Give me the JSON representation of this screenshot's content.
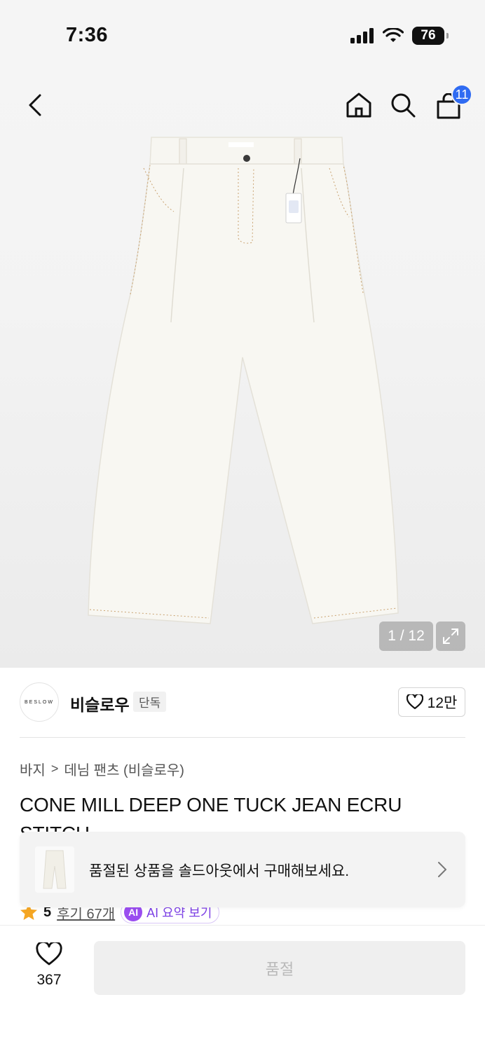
{
  "status_bar": {
    "time": "7:36",
    "battery": "76"
  },
  "nav": {
    "cart_count": "11"
  },
  "gallery": {
    "counter": "1 / 12",
    "product_tag_text": "BESLOW"
  },
  "brand": {
    "logo_text": "BESLOW",
    "name": "비슬로우",
    "tag": "단독",
    "likes": "12만"
  },
  "breadcrumb": {
    "category": "바지",
    "separator": ">",
    "subcategory": "데님 팬츠 (비슬로우)"
  },
  "product": {
    "title": "CONE MILL DEEP ONE TUCK JEAN ECRU STITCH"
  },
  "rating": {
    "score": "5",
    "reviews": "후기 67개",
    "ai_badge": "AI",
    "ai_label": "AI 요약 보기"
  },
  "toast": {
    "message": "품절된 상품을 솔드아웃에서 구매해보세요."
  },
  "bottom": {
    "wish_count": "367",
    "buy_label": "품절"
  },
  "colors": {
    "badge": "#2f6bf2",
    "star": "#f5a623",
    "ai": "#9a4df0"
  }
}
